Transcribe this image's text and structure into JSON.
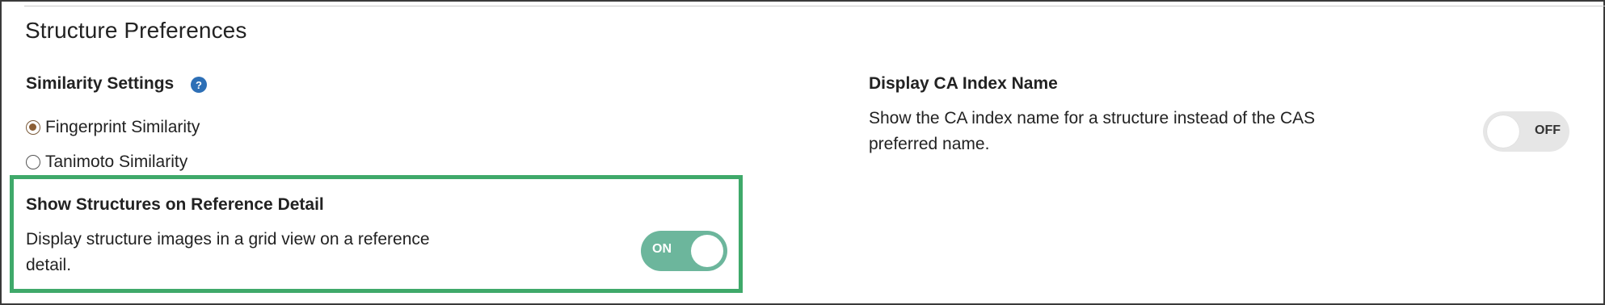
{
  "section": {
    "title": "Structure Preferences"
  },
  "similarity": {
    "title": "Similarity Settings",
    "help_icon": "question-circle-icon",
    "help_glyph": "?",
    "options": [
      {
        "label": "Fingerprint Similarity",
        "checked": true
      },
      {
        "label": "Tanimoto Similarity",
        "checked": false
      }
    ]
  },
  "reference_detail": {
    "title": "Show Structures on Reference Detail",
    "description": "Display structure images in a grid view on a reference detail.",
    "toggle_label": "ON",
    "enabled": true,
    "highlight_color": "#3fa96a"
  },
  "ca_index": {
    "title": "Display CA Index Name",
    "description": "Show the CA index name for a structure instead of the CAS preferred name.",
    "toggle_label": "OFF",
    "enabled": false
  },
  "colors": {
    "toggle_on": "#6cb69c",
    "toggle_off": "#e6e6e6",
    "radio_selected": "#8b5e34",
    "help_icon": "#2d6fb6"
  }
}
